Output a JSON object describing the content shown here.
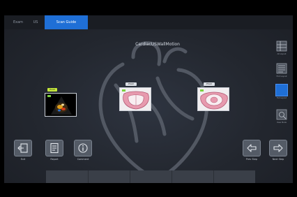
{
  "tabs": {
    "exam": "Exam",
    "us": "US",
    "scan_guide": "Scan Guide"
  },
  "protocol": {
    "title": "CardiacUSWallMotion",
    "subtitle": ""
  },
  "thumbnails": [
    {
      "label": "PLAX",
      "state": "acquired"
    },
    {
      "label": "PSAX",
      "state": "pending"
    },
    {
      "label": "PSAX",
      "state": "pending"
    }
  ],
  "side_tools": {
    "tool1": "All Layout",
    "tool2": "Hint Layout",
    "tool3": "Full Layout",
    "tool4": "View Mode"
  },
  "actions": {
    "exit": "Exit",
    "report": "Report",
    "comment": "Comment",
    "prev_step": "Prev Step",
    "next_step": "Next Step"
  },
  "colors": {
    "accent": "#1f6fd6",
    "acquired_tag": "#c6e93b",
    "background": "#23272f"
  },
  "icons": {
    "exit": "exit-icon",
    "report": "report-icon",
    "comment": "info-icon",
    "prev": "arrow-left-icon",
    "next": "arrow-right-icon"
  }
}
